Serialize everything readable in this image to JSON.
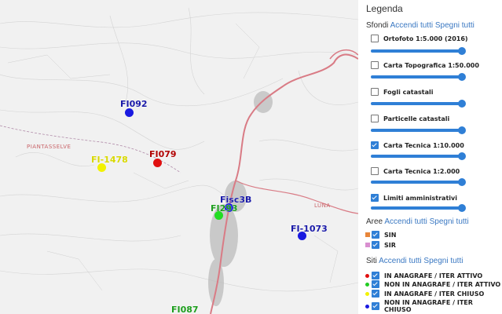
{
  "map": {
    "places": [
      "PIANTASSELVE",
      "LUNA"
    ],
    "markers": [
      {
        "label": "FI092",
        "label_color": "#1a1aa8",
        "dot_color": "#1a1ae0"
      },
      {
        "label": "FI-1478",
        "label_color": "#d8d800",
        "dot_color": "#f2f200"
      },
      {
        "label": "FI079",
        "label_color": "#b00000",
        "dot_color": "#e01010"
      },
      {
        "label": "Fisc3B",
        "label_color": "#1a1aa8",
        "dot_color": "#1a1ae0"
      },
      {
        "label": "FI293",
        "label_color": "#1e9e1e",
        "dot_color": "#22dd22"
      },
      {
        "label": "FI-1073",
        "label_color": "#1a1aa8",
        "dot_color": "#1a1ae0"
      },
      {
        "label": "FI087",
        "label_color": "#1e9e1e",
        "dot_color": "#22dd22"
      }
    ]
  },
  "legend": {
    "title": "Legenda",
    "sfondi": {
      "title": "Sfondi",
      "on_all": "Accendi tutti",
      "off_all": "Spegni tutti",
      "layers": [
        {
          "label": "Ortofoto 1:5.000 (2016)",
          "checked": false
        },
        {
          "label": "Carta Topografica 1:50.000",
          "checked": false
        },
        {
          "label": "Fogli catastali",
          "checked": false
        },
        {
          "label": "Particelle catastali",
          "checked": false
        },
        {
          "label": "Carta Tecnica 1:10.000",
          "checked": true
        },
        {
          "label": "Carta Tecnica 1:2.000",
          "checked": false
        },
        {
          "label": "Limiti amministrativi",
          "checked": true
        }
      ]
    },
    "aree": {
      "title": "Aree",
      "on_all": "Accendi tutti",
      "off_all": "Spegni tutti",
      "items": [
        {
          "label": "SIN",
          "color": "#e8863a",
          "checked": true
        },
        {
          "label": "SIR",
          "color": "#d98fd0",
          "checked": true
        }
      ]
    },
    "siti": {
      "title": "Siti",
      "on_all": "Accendi tutti",
      "off_all": "Spegni tutti",
      "items": [
        {
          "label": "IN ANAGRAFE / ITER ATTIVO",
          "color": "#e01010",
          "checked": true
        },
        {
          "label": "NON IN ANAGRAFE / ITER ATTIVO",
          "color": "#22cc22",
          "checked": true
        },
        {
          "label": "IN ANAGRAFE / ITER CHIUSO",
          "color": "#f2f200",
          "checked": true
        },
        {
          "label": "NON IN ANAGRAFE / ITER CHIUSO",
          "color": "#1a1ae0",
          "checked": true
        }
      ]
    }
  }
}
